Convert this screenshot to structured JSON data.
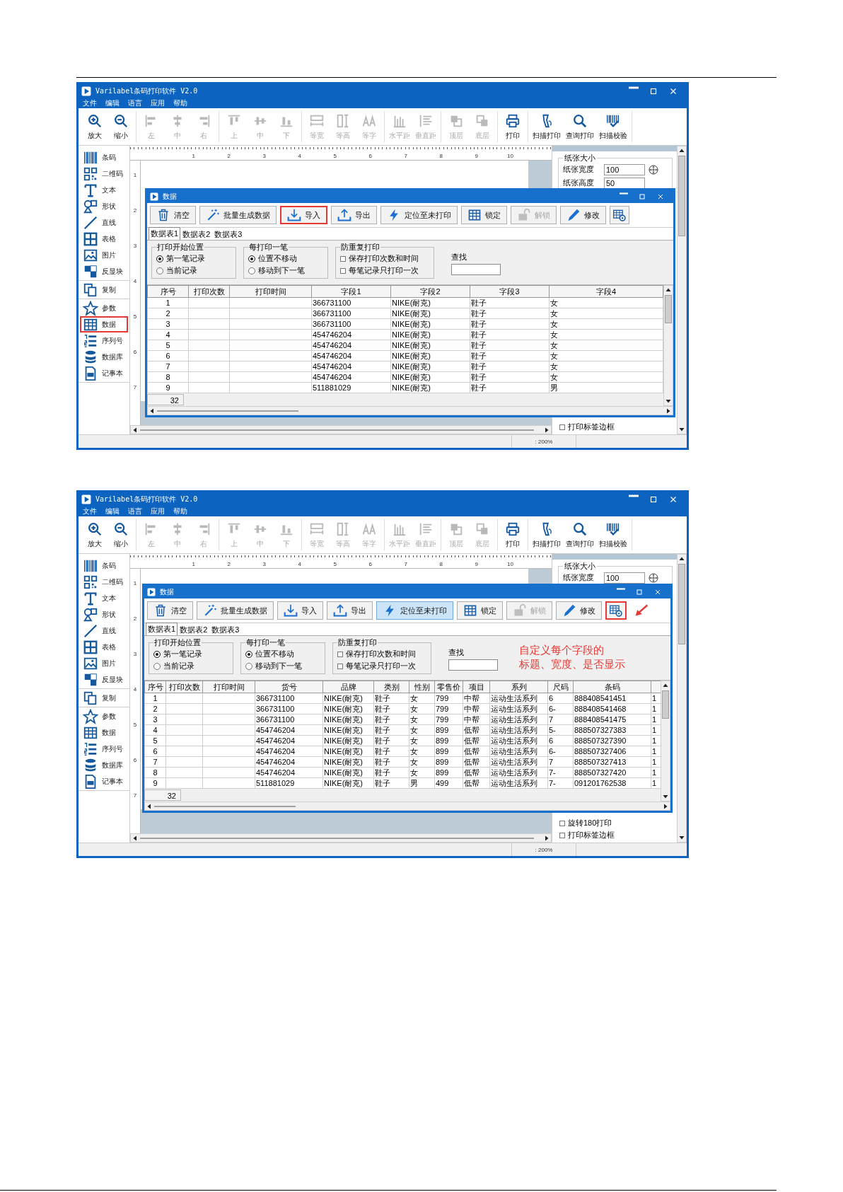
{
  "screenshots": [
    {
      "app": {
        "title": "Varilabel条码打印软件 V2.0",
        "menu": [
          "文件",
          "编辑",
          "语言",
          "应用",
          "帮助"
        ],
        "toolbar": [
          [
            {
              "label": "放大",
              "disabled": false
            },
            {
              "label": "缩小",
              "disabled": false
            }
          ],
          [
            {
              "label": "左",
              "disabled": true
            },
            {
              "label": "中",
              "disabled": true
            },
            {
              "label": "右",
              "disabled": true
            }
          ],
          [
            {
              "label": "上",
              "disabled": true
            },
            {
              "label": "中",
              "disabled": true
            },
            {
              "label": "下",
              "disabled": true
            }
          ],
          [
            {
              "label": "等宽",
              "disabled": true
            },
            {
              "label": "等高",
              "disabled": true
            },
            {
              "label": "等字",
              "disabled": true
            }
          ],
          [
            {
              "label": "水平距",
              "disabled": true
            },
            {
              "label": "垂直距",
              "disabled": true
            }
          ],
          [
            {
              "label": "顶层",
              "disabled": true
            },
            {
              "label": "底层",
              "disabled": true
            }
          ],
          [
            {
              "label": "打印",
              "disabled": false
            }
          ],
          [
            {
              "label": "扫描打印",
              "disabled": false
            },
            {
              "label": "查询打印",
              "disabled": false
            },
            {
              "label": "扫描校验",
              "disabled": false
            }
          ]
        ],
        "sidebar": [
          [
            {
              "label": "条码",
              "annotated": false
            },
            {
              "label": "二维码",
              "annotated": false
            },
            {
              "label": "文本",
              "annotated": false
            },
            {
              "label": "形状",
              "annotated": false
            },
            {
              "label": "直线",
              "annotated": false
            },
            {
              "label": "表格",
              "annotated": false
            },
            {
              "label": "图片",
              "annotated": false
            },
            {
              "label": "反显块",
              "annotated": false
            }
          ],
          [
            {
              "label": "复制",
              "annotated": false
            }
          ],
          [
            {
              "label": "参数",
              "annotated": false
            },
            {
              "label": "数据",
              "annotated": true
            },
            {
              "label": "序列号",
              "annotated": false
            },
            {
              "label": "数据库",
              "annotated": false
            },
            {
              "label": "记事本",
              "annotated": false
            }
          ]
        ],
        "ruler": [
          "1",
          "2",
          "3",
          "4",
          "5",
          "6",
          "7",
          "8",
          "9",
          "10"
        ],
        "vruler": [
          "1",
          "2",
          "3",
          "4",
          "5",
          "6",
          "7"
        ],
        "panel": {
          "group": "纸张大小",
          "fields": [
            {
              "label": "纸张宽度",
              "value": "100"
            },
            {
              "label": "纸张高度",
              "value": "50"
            }
          ],
          "options": [
            {
              "label": "打印标签边框",
              "checked": false
            }
          ]
        },
        "status": ": 200%"
      },
      "dialog": {
        "title": "数据",
        "buttons": [
          {
            "kind": "text",
            "label": "清空",
            "disabled": false,
            "highlighted": false,
            "annotated": false
          },
          {
            "kind": "text",
            "label": "批量生成数据",
            "disabled": false,
            "highlighted": false,
            "annotated": false
          },
          {
            "kind": "text",
            "label": "导入",
            "disabled": false,
            "highlighted": false,
            "annotated": true
          },
          {
            "kind": "text",
            "label": "导出",
            "disabled": false,
            "highlighted": false,
            "annotated": false
          },
          {
            "kind": "text",
            "label": "定位至未打印",
            "disabled": false,
            "highlighted": false,
            "annotated": false
          },
          {
            "kind": "text",
            "label": "锁定",
            "disabled": false,
            "highlighted": false,
            "annotated": false
          },
          {
            "kind": "text",
            "label": "解锁",
            "disabled": true,
            "highlighted": false,
            "annotated": false
          },
          {
            "kind": "text",
            "label": "修改",
            "disabled": false,
            "highlighted": false,
            "annotated": false
          },
          {
            "kind": "icon",
            "disabled": false,
            "highlighted": false,
            "annotated": false
          }
        ],
        "tabs": [
          {
            "label": "数据表1",
            "selected": true
          },
          {
            "label": "数据表2",
            "selected": false
          },
          {
            "label": "数据表3",
            "selected": false
          }
        ],
        "groups": [
          {
            "title": "打印开始位置",
            "kind": "radio",
            "options": [
              {
                "label": "第一笔记录",
                "selected": true
              },
              {
                "label": "当前记录",
                "selected": false
              }
            ]
          },
          {
            "title": "每打印一笔",
            "kind": "radio",
            "options": [
              {
                "label": "位置不移动",
                "selected": true
              },
              {
                "label": "移动到下一笔",
                "selected": false
              }
            ]
          },
          {
            "title": "防重复打印",
            "kind": "checkbox",
            "options": [
              {
                "label": "保存打印次数和时间",
                "checked": false
              },
              {
                "label": "每笔记录只打印一次",
                "checked": false
              }
            ]
          }
        ],
        "search": {
          "label": "查找"
        },
        "table": {
          "columns": [
            "序号",
            "打印次数",
            "打印时间",
            "字段1",
            "字段2",
            "字段3",
            "字段4"
          ],
          "rows": [
            [
              "1",
              null,
              null,
              "366731100",
              "NIKE(耐克)",
              "鞋子",
              "女"
            ],
            [
              "2",
              null,
              null,
              "366731100",
              "NIKE(耐克)",
              "鞋子",
              "女"
            ],
            [
              "3",
              null,
              null,
              "366731100",
              "NIKE(耐克)",
              "鞋子",
              "女"
            ],
            [
              "4",
              null,
              null,
              "454746204",
              "NIKE(耐克)",
              "鞋子",
              "女"
            ],
            [
              "5",
              null,
              null,
              "454746204",
              "NIKE(耐克)",
              "鞋子",
              "女"
            ],
            [
              "6",
              null,
              null,
              "454746204",
              "NIKE(耐克)",
              "鞋子",
              "女"
            ],
            [
              "7",
              null,
              null,
              "454746204",
              "NIKE(耐克)",
              "鞋子",
              "女"
            ],
            [
              "8",
              null,
              null,
              "454746204",
              "NIKE(耐克)",
              "鞋子",
              "女"
            ],
            [
              "9",
              null,
              null,
              "511881029",
              "NIKE(耐克)",
              "鞋子",
              "男"
            ]
          ]
        },
        "record_count": "32"
      }
    },
    {
      "app": {
        "title": "Varilabel条码打印软件 V2.0",
        "menu": [
          "文件",
          "编辑",
          "语言",
          "应用",
          "帮助"
        ],
        "toolbar": [
          [
            {
              "label": "放大",
              "disabled": false
            },
            {
              "label": "缩小",
              "disabled": false
            }
          ],
          [
            {
              "label": "左",
              "disabled": true
            },
            {
              "label": "中",
              "disabled": true
            },
            {
              "label": "右",
              "disabled": true
            }
          ],
          [
            {
              "label": "上",
              "disabled": true
            },
            {
              "label": "中",
              "disabled": true
            },
            {
              "label": "下",
              "disabled": true
            }
          ],
          [
            {
              "label": "等宽",
              "disabled": true
            },
            {
              "label": "等高",
              "disabled": true
            },
            {
              "label": "等字",
              "disabled": true
            }
          ],
          [
            {
              "label": "水平距",
              "disabled": true
            },
            {
              "label": "垂直距",
              "disabled": true
            }
          ],
          [
            {
              "label": "顶层",
              "disabled": true
            },
            {
              "label": "底层",
              "disabled": true
            }
          ],
          [
            {
              "label": "打印",
              "disabled": false
            }
          ],
          [
            {
              "label": "扫描打印",
              "disabled": false
            },
            {
              "label": "查询打印",
              "disabled": false
            },
            {
              "label": "扫描校验",
              "disabled": false
            }
          ]
        ],
        "sidebar": [
          [
            {
              "label": "条码",
              "annotated": false
            },
            {
              "label": "二维码",
              "annotated": false
            },
            {
              "label": "文本",
              "annotated": false
            },
            {
              "label": "形状",
              "annotated": false
            },
            {
              "label": "直线",
              "annotated": false
            },
            {
              "label": "表格",
              "annotated": false
            },
            {
              "label": "图片",
              "annotated": false
            },
            {
              "label": "反显块",
              "annotated": false
            }
          ],
          [
            {
              "label": "复制",
              "annotated": false
            }
          ],
          [
            {
              "label": "参数",
              "annotated": false
            },
            {
              "label": "数据",
              "annotated": false
            },
            {
              "label": "序列号",
              "annotated": false
            },
            {
              "label": "数据库",
              "annotated": false
            },
            {
              "label": "记事本",
              "annotated": false
            }
          ]
        ],
        "ruler": [
          "1",
          "2",
          "3",
          "4",
          "5",
          "6",
          "7",
          "8",
          "9",
          "10"
        ],
        "vruler": [
          "1",
          "2",
          "3",
          "4",
          "5",
          "6",
          "7"
        ],
        "panel": {
          "group": "纸张大小",
          "fields": [
            {
              "label": "纸张宽度",
              "value": "100"
            }
          ],
          "options": [
            {
              "label": "旋转180打印",
              "checked": false
            },
            {
              "label": "打印标签边框",
              "checked": false
            }
          ]
        },
        "status": ": 200%"
      },
      "dialog": {
        "title": "数据",
        "buttons": [
          {
            "kind": "text",
            "label": "清空",
            "disabled": false,
            "highlighted": false,
            "annotated": false
          },
          {
            "kind": "text",
            "label": "批量生成数据",
            "disabled": false,
            "highlighted": false,
            "annotated": false
          },
          {
            "kind": "text",
            "label": "导入",
            "disabled": false,
            "highlighted": false,
            "annotated": false
          },
          {
            "kind": "text",
            "label": "导出",
            "disabled": false,
            "highlighted": false,
            "annotated": false
          },
          {
            "kind": "text",
            "label": "定位至未打印",
            "disabled": false,
            "highlighted": true,
            "annotated": false
          },
          {
            "kind": "text",
            "label": "锁定",
            "disabled": false,
            "highlighted": false,
            "annotated": false
          },
          {
            "kind": "text",
            "label": "解锁",
            "disabled": true,
            "highlighted": false,
            "annotated": false
          },
          {
            "kind": "text",
            "label": "修改",
            "disabled": false,
            "highlighted": false,
            "annotated": false
          },
          {
            "kind": "icon",
            "disabled": false,
            "highlighted": false,
            "annotated": true
          }
        ],
        "annotation_arrow": true,
        "tabs": [
          {
            "label": "数据表1",
            "selected": true
          },
          {
            "label": "数据表2",
            "selected": false
          },
          {
            "label": "数据表3",
            "selected": false
          }
        ],
        "groups": [
          {
            "title": "打印开始位置",
            "kind": "radio",
            "options": [
              {
                "label": "第一笔记录",
                "selected": true
              },
              {
                "label": "当前记录",
                "selected": false
              }
            ]
          },
          {
            "title": "每打印一笔",
            "kind": "radio",
            "options": [
              {
                "label": "位置不移动",
                "selected": true
              },
              {
                "label": "移动到下一笔",
                "selected": false
              }
            ]
          },
          {
            "title": "防重复打印",
            "kind": "checkbox",
            "options": [
              {
                "label": "保存打印次数和时间",
                "checked": false
              },
              {
                "label": "每笔记录只打印一次",
                "checked": false
              }
            ]
          }
        ],
        "search": {
          "label": "查找"
        },
        "note": [
          "自定义每个字段的",
          "标题、宽度、是否显示"
        ],
        "table": {
          "columns": [
            "序号",
            "打印次数",
            "打印时间",
            "货号",
            "品牌",
            "类别",
            "性别",
            "零售价",
            "项目",
            "系列",
            "尺码",
            "条码"
          ],
          "rows": [
            [
              "1",
              null,
              null,
              "366731100",
              "NIKE(耐克)",
              "鞋子",
              "女",
              "799",
              "中帮",
              "运动生活系列",
              "6",
              "888408541451",
              "1"
            ],
            [
              "2",
              null,
              null,
              "366731100",
              "NIKE(耐克)",
              "鞋子",
              "女",
              "799",
              "中帮",
              "运动生活系列",
              "6-",
              "888408541468",
              "1"
            ],
            [
              "3",
              null,
              null,
              "366731100",
              "NIKE(耐克)",
              "鞋子",
              "女",
              "799",
              "中帮",
              "运动生活系列",
              "7",
              "888408541475",
              "1"
            ],
            [
              "4",
              null,
              null,
              "454746204",
              "NIKE(耐克)",
              "鞋子",
              "女",
              "899",
              "低帮",
              "运动生活系列",
              "5-",
              "888507327383",
              "1"
            ],
            [
              "5",
              null,
              null,
              "454746204",
              "NIKE(耐克)",
              "鞋子",
              "女",
              "899",
              "低帮",
              "运动生活系列",
              "6",
              "888507327390",
              "1"
            ],
            [
              "6",
              null,
              null,
              "454746204",
              "NIKE(耐克)",
              "鞋子",
              "女",
              "899",
              "低帮",
              "运动生活系列",
              "6-",
              "888507327406",
              "1"
            ],
            [
              "7",
              null,
              null,
              "454746204",
              "NIKE(耐克)",
              "鞋子",
              "女",
              "899",
              "低帮",
              "运动生活系列",
              "7",
              "888507327413",
              "1"
            ],
            [
              "8",
              null,
              null,
              "454746204",
              "NIKE(耐克)",
              "鞋子",
              "女",
              "899",
              "低帮",
              "运动生活系列",
              "7-",
              "888507327420",
              "1"
            ],
            [
              "9",
              null,
              null,
              "511881029",
              "NIKE(耐克)",
              "鞋子",
              "男",
              "499",
              "低帮",
              "运动生活系列",
              "7-",
              "091201762538",
              "1"
            ]
          ]
        },
        "record_count": "32"
      }
    }
  ]
}
